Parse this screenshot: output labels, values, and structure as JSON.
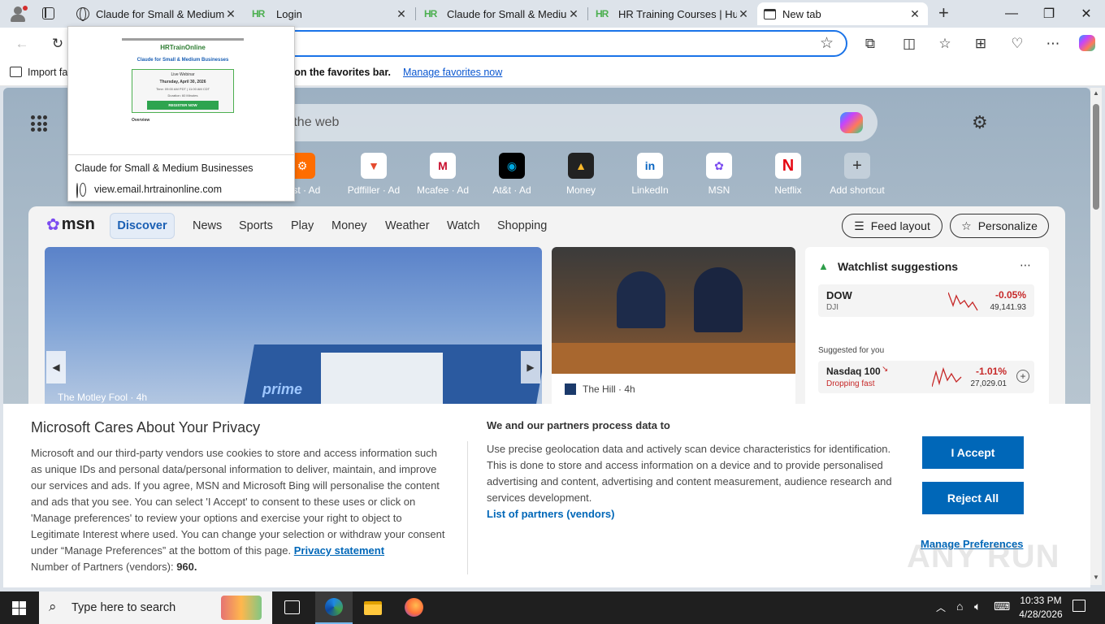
{
  "tabs": [
    {
      "title": "Claude for Small & Medium Businesses",
      "icon": "globe-icon"
    },
    {
      "title": "Login",
      "icon": "hr-icon"
    },
    {
      "title": "Claude for Small & Medium Businesses",
      "icon": "hr-icon"
    },
    {
      "title": "HR Training Courses | Human Resources",
      "icon": "hr-icon"
    },
    {
      "title": "New tab",
      "icon": "newtab-icon"
    }
  ],
  "favbar": {
    "import_label": "Import fa",
    "hint": "ere on the favorites bar.",
    "manage_link": "Manage favorites now"
  },
  "search": {
    "placeholder": "ch the web"
  },
  "shortcuts": [
    "rast · Ad",
    "Pdffiller · Ad",
    "Mcafee · Ad",
    "At&t · Ad",
    "Money",
    "LinkedIn",
    "MSN",
    "Netflix",
    "Add shortcut"
  ],
  "msn": {
    "logo": "msn",
    "nav": [
      "Discover",
      "News",
      "Sports",
      "Play",
      "Money",
      "Weather",
      "Watch",
      "Shopping"
    ],
    "feed_layout": "Feed layout",
    "personalize": "Personalize",
    "card1_source": "The Motley Fool",
    "card1_time": "· 4h",
    "card1_truck": "prime",
    "card2_source": "The Hill",
    "card2_time": "· 4h",
    "watch_title": "Watchlist suggestions",
    "suggested": "Suggested for you",
    "stocks": [
      {
        "name": "DOW",
        "sub": "DJI",
        "change": "-0.05%",
        "value": "49,141.93"
      },
      {
        "name": "Nasdaq 100",
        "sub": "Dropping fast",
        "change": "-1.01%",
        "value": "27,029.01"
      }
    ]
  },
  "preview": {
    "title": "Claude for Small & Medium Businesses",
    "url": "view.email.hrtrainonline.com",
    "thumb_brand": "HRTrainOnline",
    "thumb_heading": "Claude for Small & Medium Businesses",
    "thumb_live": "Live Webinar",
    "thumb_date": "Thursday, April 30, 2026",
    "thumb_time": "Time: 09:00 AM PDT | 11:00 AM CDT",
    "thumb_duration": "Duration: 60 Minutes",
    "thumb_button": "REGISTER NOW",
    "thumb_overview": "Overview"
  },
  "privacy": {
    "title": "Microsoft Cares About Your Privacy",
    "body": "Microsoft and our third-party vendors use cookies to store and access information such as unique IDs and personal data/personal information to deliver, maintain, and improve our services and ads. If you agree, MSN and Microsoft Bing will personalise the content and ads that you see. You can select 'I Accept' to consent to these uses or click on 'Manage preferences' to review your options and exercise your right to object to Legitimate Interest where used. You can change your selection or withdraw your consent under “Manage Preferences” at the bottom of this page.",
    "privacy_link": "Privacy statement",
    "partners_label": "Number of Partners (vendors):",
    "partners_count": "960.",
    "right_title": "We and our partners process data to",
    "right_body": "Use precise geolocation data and actively scan device characteristics for identification. This is done to store and access information on a device and to provide personalised advertising and content, advertising and content measurement, audience research and services development.",
    "partners_link": "List of partners (vendors)",
    "accept": "I Accept",
    "reject": "Reject All",
    "manage": "Manage Preferences"
  },
  "taskbar": {
    "search_placeholder": "Type here to search",
    "time": "10:33 PM",
    "date": "4/28/2026"
  },
  "watermark": "ANY RUN"
}
